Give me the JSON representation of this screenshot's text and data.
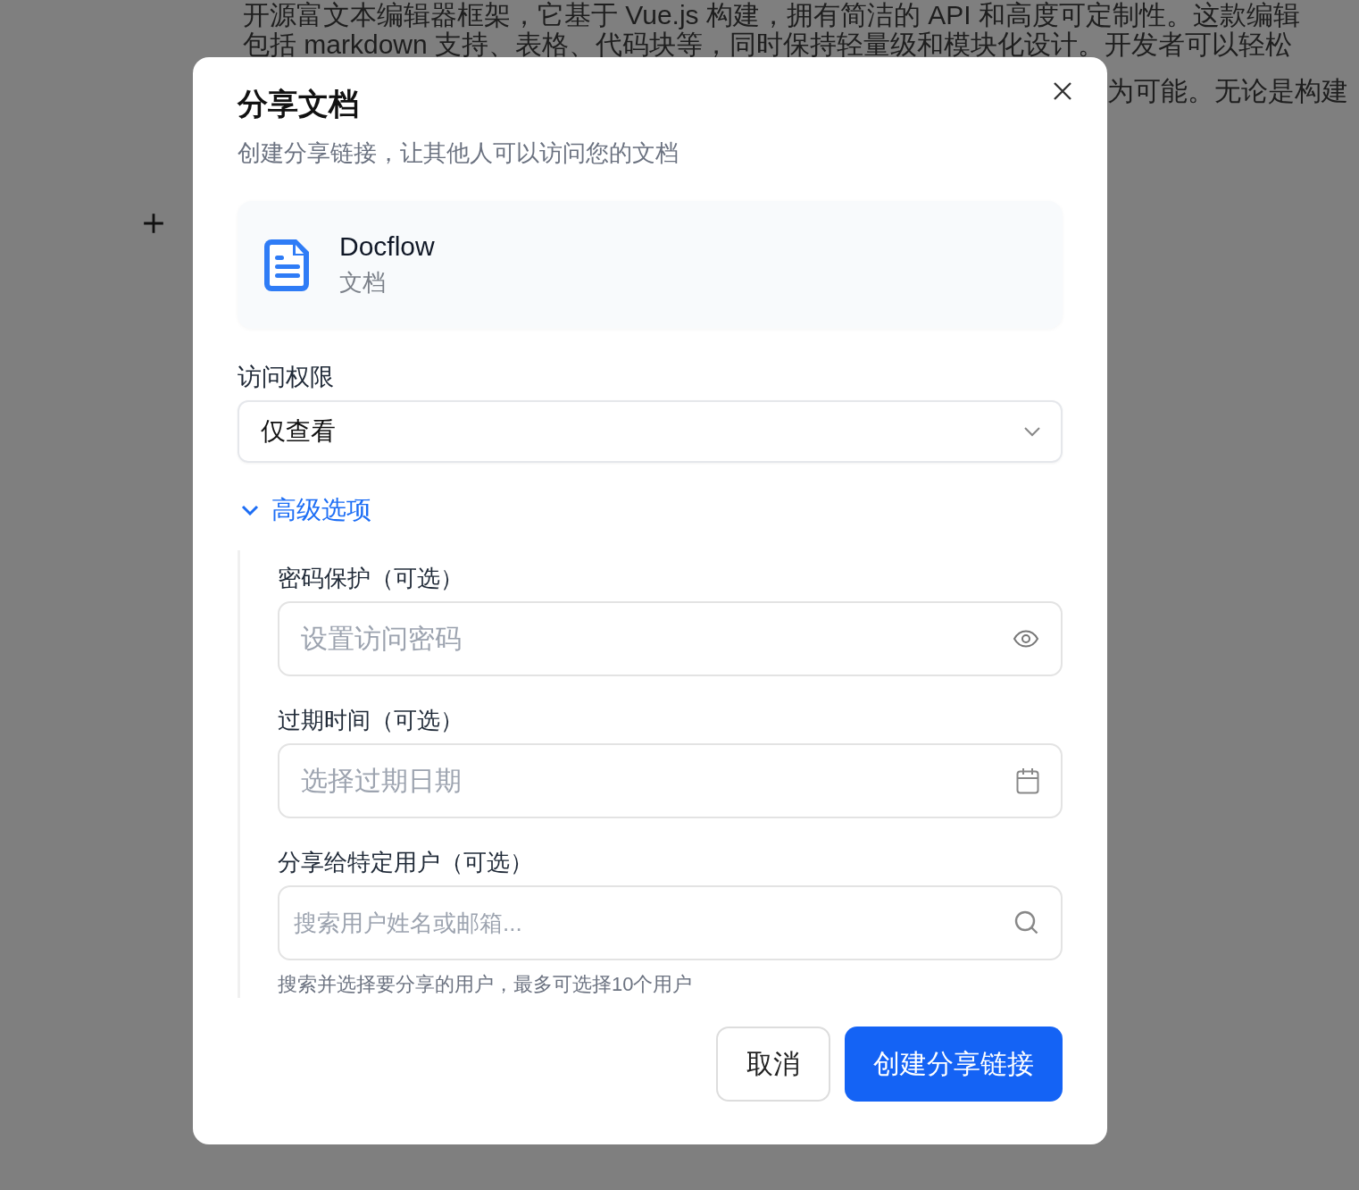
{
  "background": {
    "lines": [
      "开源富文本编辑器框架，它基于 Vue.js 构建，拥有简洁的 API 和高度可定制性。这款编辑",
      "包括 markdown 支持、表格、代码块等，同时保持轻量级和模块化设计。开发者可以轻松"
    ],
    "partial_line": "为可能。无论是构建"
  },
  "dialog": {
    "title": "分享文档",
    "subtitle": "创建分享链接，让其他人可以访问您的文档",
    "document": {
      "name": "Docflow",
      "type": "文档"
    },
    "access": {
      "label": "访问权限",
      "value": "仅查看"
    },
    "advanced": {
      "label": "高级选项",
      "expanded": true,
      "fields": [
        {
          "label": "密码保护（可选）",
          "placeholder": "设置访问密码",
          "kind": "password"
        },
        {
          "label": "过期时间（可选）",
          "placeholder": "选择过期日期",
          "kind": "date"
        },
        {
          "label": "分享给特定用户（可选）",
          "placeholder": "搜索用户姓名或邮箱...",
          "kind": "search"
        }
      ],
      "help": "搜索并选择要分享的用户，最多可选择10个用户"
    },
    "buttons": [
      {
        "label": "取消",
        "kind": "secondary"
      },
      {
        "label": "创建分享链接",
        "kind": "primary"
      }
    ]
  }
}
